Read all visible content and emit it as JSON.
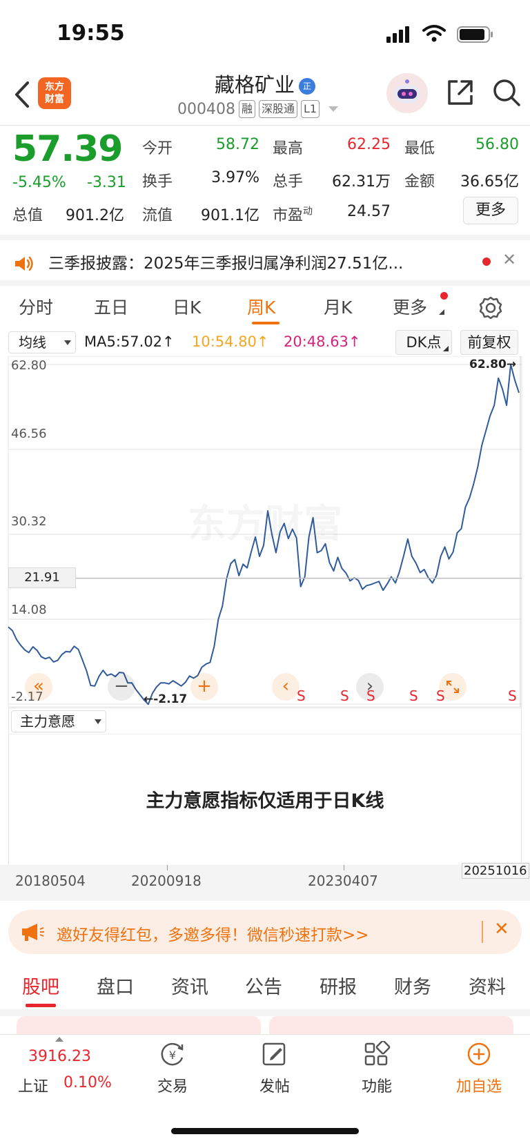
{
  "status_bar": {
    "time": "19:55"
  },
  "header": {
    "logo_text_1": "东方",
    "logo_text_2": "财富",
    "stock_name": "藏格矿业",
    "badge": "正",
    "stock_code": "000408",
    "tags": [
      "融",
      "深股通",
      "L1"
    ]
  },
  "quote": {
    "price": "57.39",
    "change_pct": "-5.45%",
    "change_abs": "-3.31",
    "fields": [
      {
        "label": "今开",
        "value": "58.72",
        "color": "#1a9d2a"
      },
      {
        "label": "最高",
        "value": "62.25",
        "color": "#e8262e"
      },
      {
        "label": "最低",
        "value": "56.80",
        "color": "#1a9d2a"
      },
      {
        "label": "换手",
        "value": "3.97%",
        "color": "#222222"
      },
      {
        "label": "总手",
        "value": "62.31万",
        "color": "#222222"
      },
      {
        "label": "金额",
        "value": "36.65亿",
        "color": "#222222"
      },
      {
        "label": "总值",
        "value": "901.2亿",
        "color": "#222222"
      },
      {
        "label": "流值",
        "value": "901.1亿",
        "color": "#222222"
      },
      {
        "label": "市盈",
        "label_sup": "动",
        "value": "24.57",
        "color": "#222222"
      }
    ],
    "more_label": "更多"
  },
  "announcement": {
    "text": "三季报披露：2025年三季报归属净利润27.51亿..."
  },
  "period_tabs": {
    "tabs": [
      "分时",
      "五日",
      "日K",
      "周K",
      "月K",
      "更多"
    ],
    "active": "周K"
  },
  "indicator_bar": {
    "select_label": "均线",
    "ma5": "MA5:57.02",
    "ma10": "10:54.80",
    "ma20": "20:48.63",
    "dk_label": "DK点",
    "adjust_label": "前复权"
  },
  "chart_data": {
    "type": "line",
    "y_ticks": [
      "62.80",
      "46.56",
      "30.32",
      "14.08",
      "-2.17"
    ],
    "ylim": [
      -2.17,
      62.8
    ],
    "crosshair_label": "21.91",
    "max_label": "62.80",
    "min_label": "-2.17",
    "x_ticks": [
      "20180504",
      "20200918",
      "20230407",
      "20251016"
    ],
    "signal_label": "S",
    "signal_count": 6,
    "series": [
      {
        "values": [
          12.6,
          11.9,
          10.2,
          9.1,
          8.2,
          7.7,
          8.8,
          8.1,
          6.9,
          6.5,
          6.8,
          5.9,
          6.2,
          7.3,
          7.9,
          7.8,
          8.9,
          8.3,
          6.3,
          4.2,
          1.4,
          1.3,
          3.1,
          4.3,
          3.3,
          3.6,
          3.1,
          3.9,
          3.8,
          1.9,
          1.9,
          0.6,
          -0.4,
          -1.4,
          -2.2,
          -0.1,
          1.1,
          1.9,
          1.9,
          1.7,
          2.3,
          1.8,
          1.3,
          2.0,
          3.2,
          2.8,
          3.3,
          4.9,
          5.5,
          5.8,
          8.9,
          14.1,
          16.6,
          21.8,
          24.7,
          25.5,
          22.4,
          24.6,
          23.9,
          27.0,
          29.8,
          26.1,
          28.2,
          34.8,
          30.4,
          26.8,
          30.8,
          32.4,
          29.5,
          31.3,
          29.6,
          20.3,
          22.2,
          29.8,
          33.5,
          26.8,
          27.2,
          28.5,
          24.9,
          23.3,
          25.9,
          23.8,
          22.9,
          21.4,
          22.0,
          21.5,
          19.8,
          20.5,
          20.7,
          21.0,
          21.3,
          19.6,
          20.8,
          22.2,
          21.0,
          23.2,
          26.2,
          29.4,
          26.1,
          24.8,
          23.0,
          23.6,
          22.0,
          21.0,
          22.5,
          26.1,
          27.9,
          25.6,
          26.9,
          30.6,
          31.4,
          35.5,
          37.3,
          40.0,
          43.2,
          47.4,
          50.2,
          53.0,
          55.0,
          60.2,
          58.1,
          55.0,
          62.8,
          59.8,
          57.4
        ]
      }
    ]
  },
  "sub_panel": {
    "select_label": "主力意愿",
    "message": "主力意愿指标仅适用于日K线"
  },
  "invite_banner": {
    "text": "邀好友得红包，多邀多得！微信秒速打款>>"
  },
  "section_tabs": {
    "tabs": [
      "股吧",
      "盘口",
      "资讯",
      "公告",
      "研报",
      "财务",
      "资料"
    ],
    "active": "股吧"
  },
  "bottom_nav": {
    "index_value": "3916.23",
    "index_name": "上证",
    "index_pct": "0.10%",
    "items": [
      "交易",
      "发帖",
      "功能",
      "加自选"
    ]
  },
  "colors": {
    "accent": "#f0720f",
    "up": "#e8262e",
    "down": "#1a9d2a",
    "line": "#2f5b9c",
    "ma10": "#f5a623",
    "ma20": "#d4237a"
  }
}
